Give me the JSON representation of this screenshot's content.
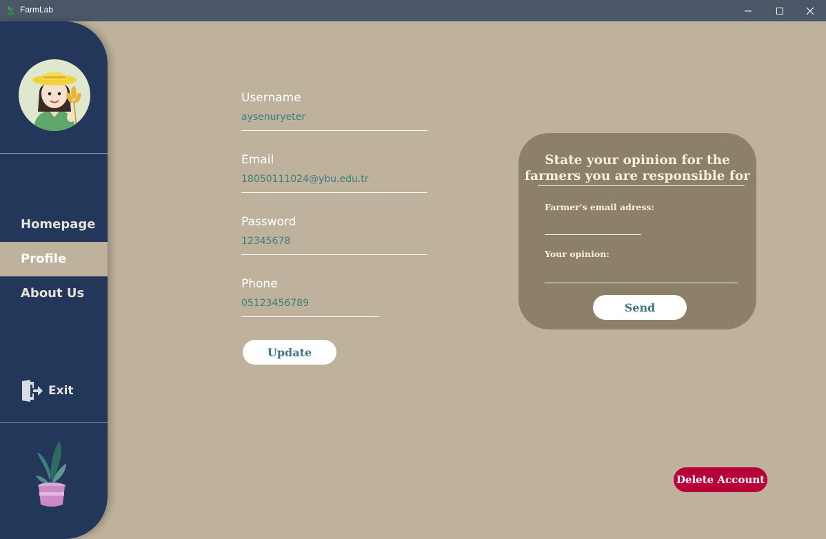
{
  "window": {
    "title": "FarmLab"
  },
  "sidebar": {
    "items": [
      {
        "label": "Homepage",
        "active": false
      },
      {
        "label": "Profile",
        "active": true
      },
      {
        "label": "About Us",
        "active": false
      }
    ],
    "exit_label": "Exit"
  },
  "profile": {
    "username": {
      "label": "Username",
      "value": "aysenuryeter"
    },
    "email": {
      "label": "Email",
      "value": "18050111024@ybu.edu.tr"
    },
    "password": {
      "label": "Password",
      "value": "12345678"
    },
    "phone": {
      "label": "Phone",
      "value": "05123456789"
    },
    "update_label": "Update"
  },
  "opinion": {
    "title_line1": "State your opinion for the",
    "title_line2": "farmers you are responsible for",
    "email_label": "Farmer's email adress:",
    "opinion_label": "Your opinion:",
    "send_label": "Send"
  },
  "delete_label": "Delete Account",
  "colors": {
    "background": "#beb29d",
    "sidebar": "#23375a",
    "card": "#8c8168",
    "delete": "#b80038",
    "value_text": "#3f7c7e"
  }
}
